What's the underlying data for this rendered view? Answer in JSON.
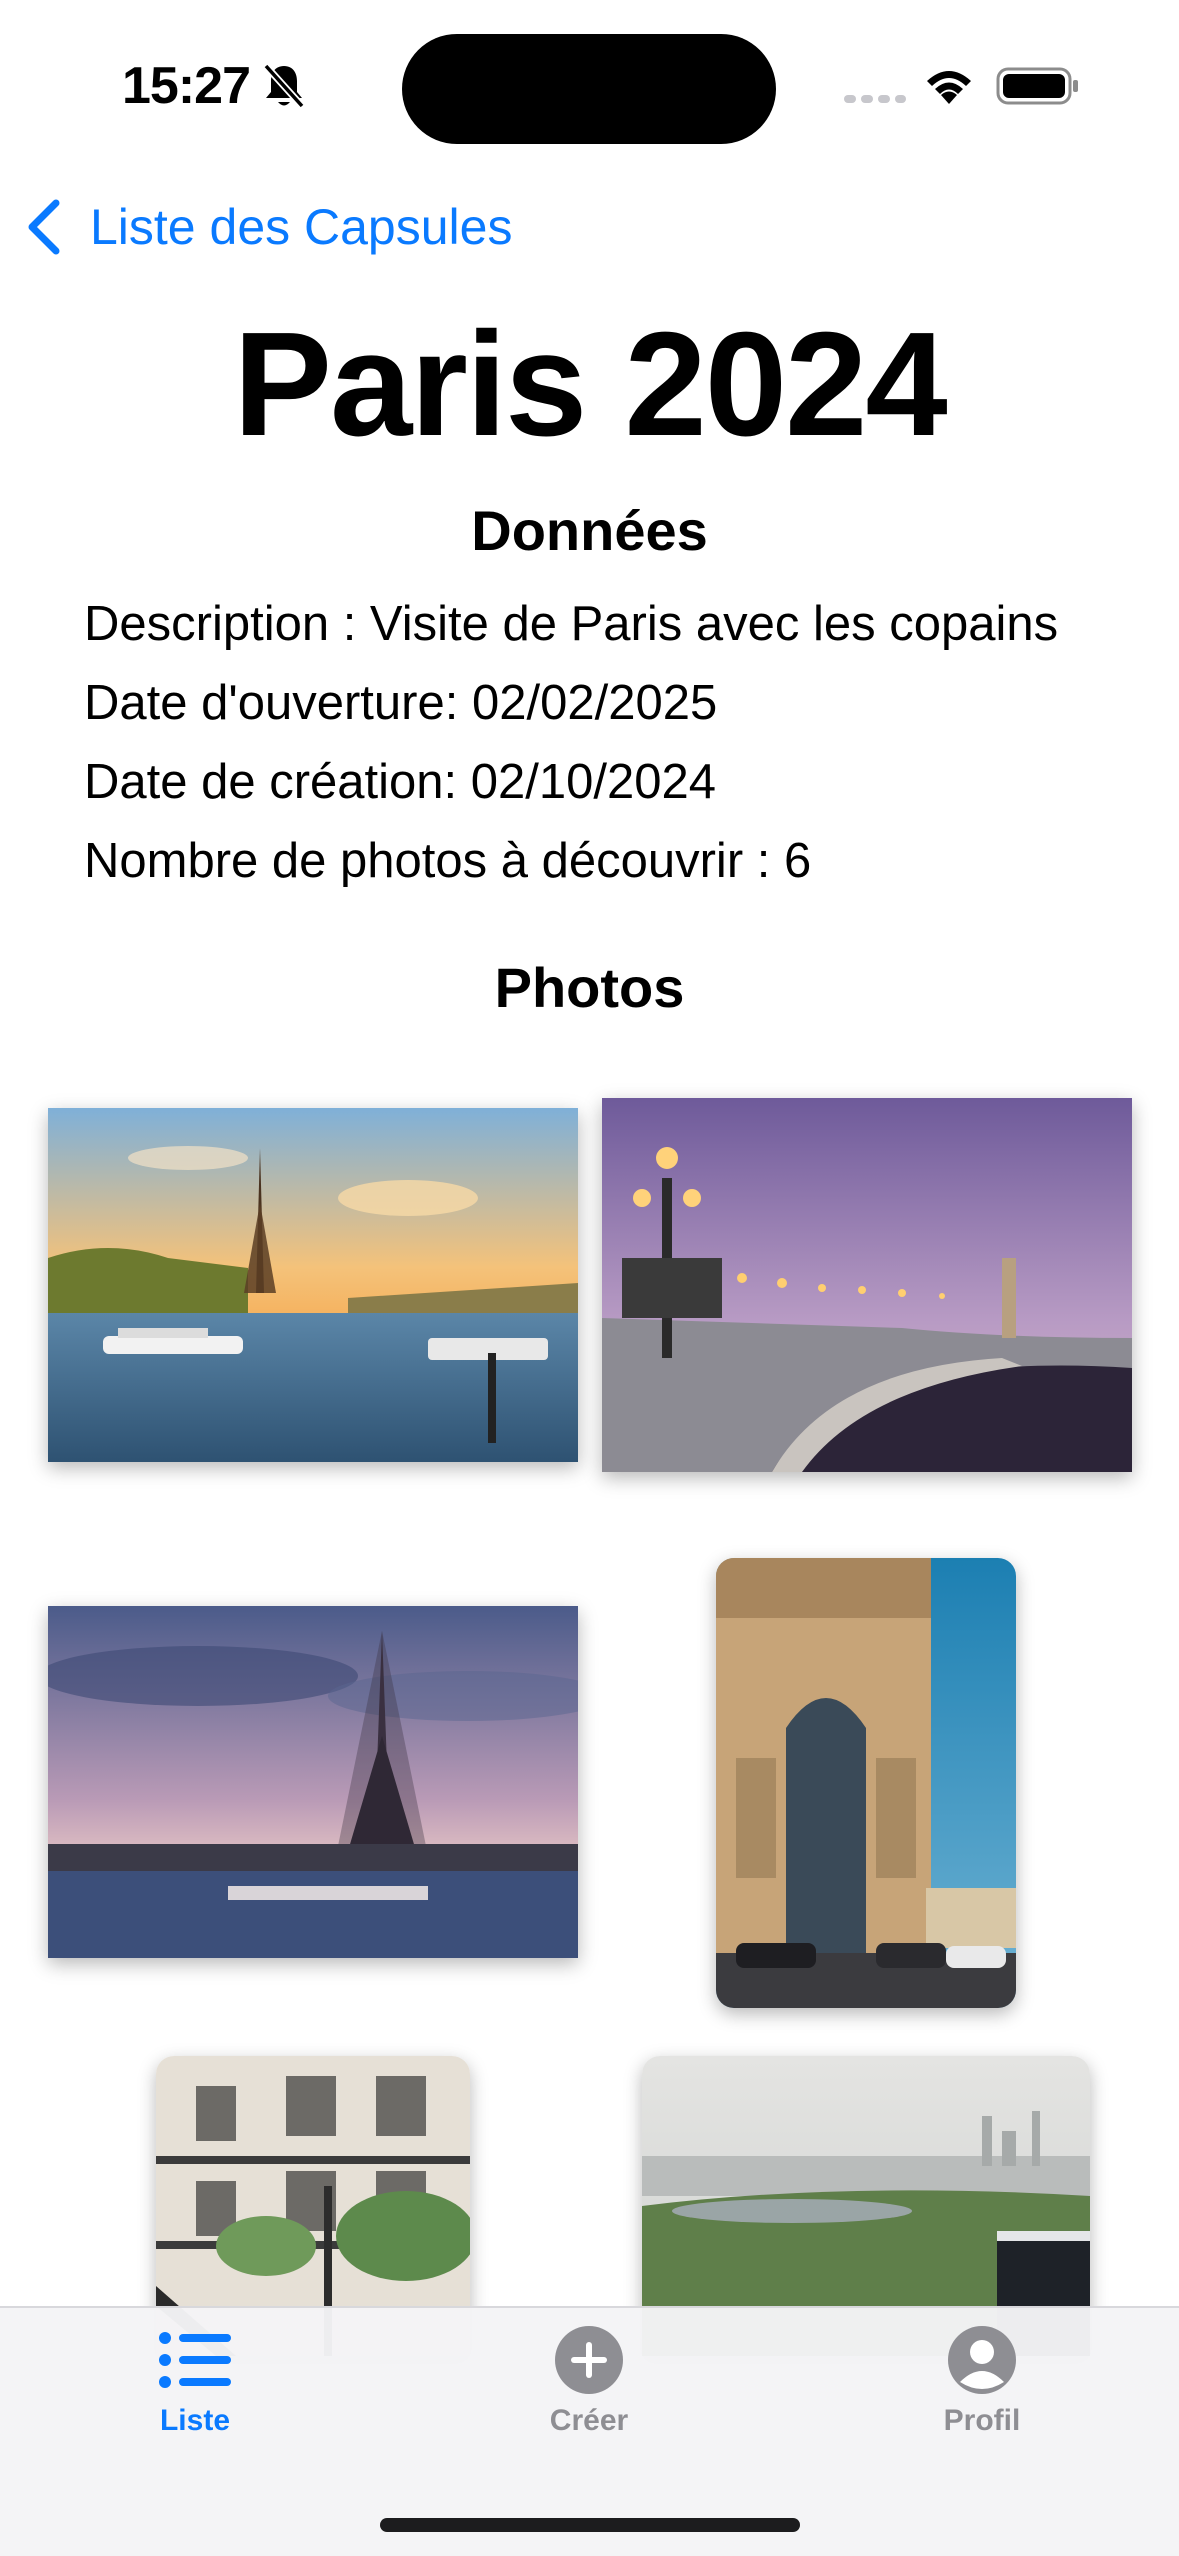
{
  "status_bar": {
    "time": "15:27"
  },
  "navigation": {
    "back_label": "Liste des Capsules"
  },
  "capsule": {
    "title": "Paris 2024",
    "data_section_title": "Données",
    "description_line": "Description : Visite de Paris avec les copains",
    "opening_date_line": "Date d'ouverture: 02/02/2025",
    "creation_date_line": "Date de création: 02/10/2024",
    "photo_count_line": "Nombre de photos à découvrir : 6"
  },
  "photos_section": {
    "title": "Photos"
  },
  "tab_bar": {
    "tabs": [
      {
        "label": "Liste",
        "icon": "list-icon",
        "selected": true
      },
      {
        "label": "Créer",
        "icon": "plus-circle-icon",
        "selected": false
      },
      {
        "label": "Profil",
        "icon": "person-circle-icon",
        "selected": false
      }
    ],
    "active_color": "#0A7AFF",
    "inactive_color": "#8E8E93"
  }
}
